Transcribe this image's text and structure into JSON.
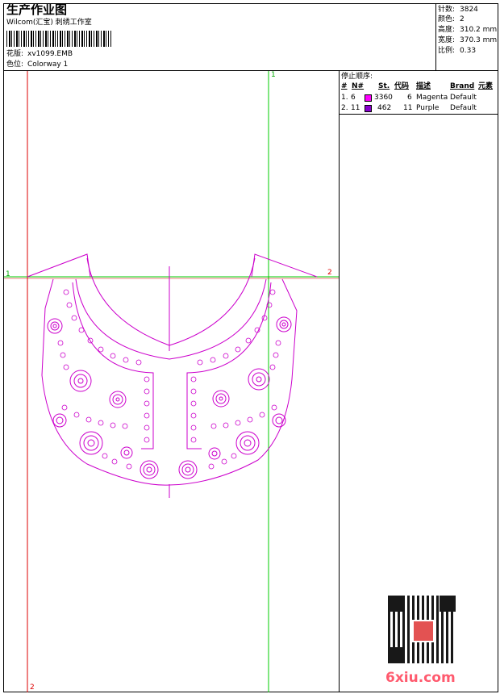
{
  "header": {
    "title": "生产作业图",
    "studio": "Wilcom(汇宝) 刺绣工作室",
    "design_label": "花版:",
    "design_value": "xv1099.EMB",
    "colorway_label": "色位:",
    "colorway_value": "Colorway 1"
  },
  "stats": [
    {
      "label": "针数:",
      "value": "3824"
    },
    {
      "label": "颜色:",
      "value": "2"
    },
    {
      "label": "高度:",
      "value": "310.2 mm"
    },
    {
      "label": "宽度:",
      "value": "370.3 mm"
    },
    {
      "label": "比例:",
      "value": "0.33"
    }
  ],
  "stop_sequence": {
    "title": "停止顺序:",
    "columns": [
      "#",
      "N#",
      "St.",
      "代码",
      "描述",
      "Brand",
      "元素"
    ],
    "rows": [
      {
        "index": "1.",
        "needle": "6",
        "stitches": "3360",
        "code": "6",
        "description": "Magenta",
        "brand": "Default",
        "color": "#ff00ff"
      },
      {
        "index": "2.",
        "needle": "11",
        "stitches": "462",
        "code": "11",
        "description": "Purple",
        "brand": "Default",
        "color": "#8800cc"
      }
    ]
  },
  "guides": {
    "top_marker": "1",
    "left_marker": "1",
    "right_marker": "2",
    "bottom_marker": "2"
  },
  "colors": {
    "design": "#cc00cc",
    "guide_red": "#dd0000",
    "guide_green": "#00cc00"
  },
  "watermark": {
    "text": "6xiu.com",
    "qr_icon": "qr-code-icon"
  }
}
